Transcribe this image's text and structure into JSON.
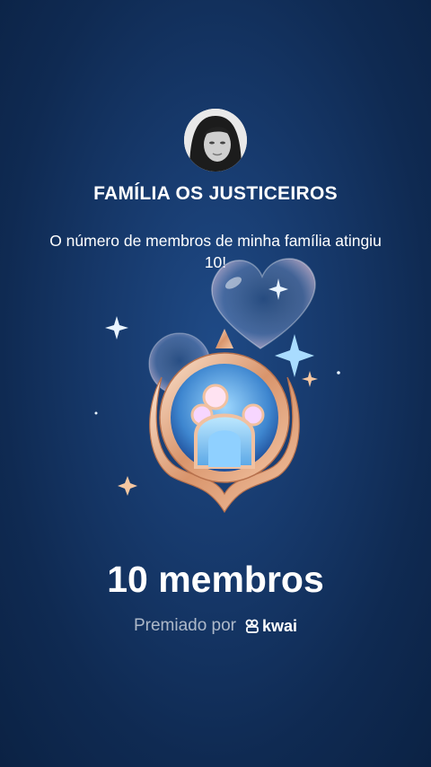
{
  "family": {
    "name": "FAMÍLIA OS JUSTICEIROS",
    "message": "O número de membros de minha família atingiu 10!"
  },
  "achievement": {
    "count_label": "10 membros"
  },
  "footer": {
    "awarded_by": "Premiado por",
    "brand": "kwai"
  },
  "icons": [
    "avatar",
    "family-badge-icon",
    "heart-bubble-icon",
    "sparkle-icon",
    "kwai-logo-icon"
  ],
  "colors": {
    "background": "#173a6d",
    "badge_gold": "#e9b08a",
    "badge_blue": "#7cc6f2"
  }
}
